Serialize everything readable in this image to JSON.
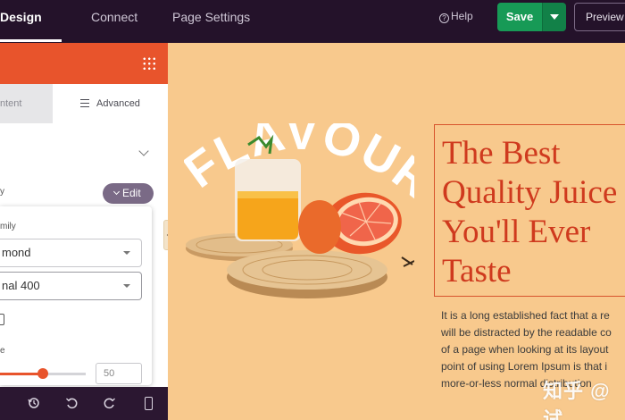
{
  "topbar": {
    "tabs": [
      {
        "label": "Design",
        "active": true
      },
      {
        "label": "Connect",
        "active": false
      },
      {
        "label": "Page Settings",
        "active": false
      }
    ],
    "help_label": "Help",
    "save_label": "Save",
    "preview_label": "Preview"
  },
  "panel": {
    "subtab_content": "ntent",
    "subtab_advanced": "Advanced",
    "label_style": "y",
    "edit_label": "Edit",
    "label_font_family": "mily",
    "font_family_value": "mond",
    "font_weight_value": "nal 400",
    "label_size": "e",
    "size_value": "50",
    "size_fraction": 0.5,
    "colors": {
      "accent": "#e8542c",
      "panel_footer": "#2b1731",
      "topbar": "#24122a",
      "save": "#179a56"
    }
  },
  "canvas": {
    "art_word": "FLAVOUR",
    "headline_lines": [
      "The Best",
      "Quality Juice",
      "You'll Ever",
      "Taste"
    ],
    "body_lines": [
      "It is a long established fact that a re",
      "will be distracted by the readable co",
      "of a page when looking at its layout",
      "point of using Lorem Ipsum is that i",
      "more-or-less normal distribution"
    ],
    "watermark": "知乎 @试",
    "colors": {
      "background": "#f8c98d",
      "headline": "#cf3a1e"
    }
  }
}
